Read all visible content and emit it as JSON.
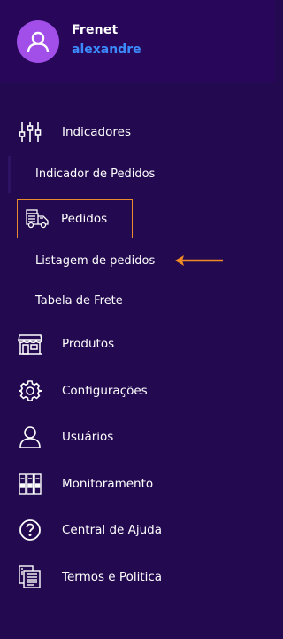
{
  "header": {
    "brand": "Frenet",
    "username": "alexandre"
  },
  "nav": {
    "indicadores": {
      "label": "Indicadores",
      "icon": "sliders-icon"
    },
    "indicador_pedidos": {
      "label": "Indicador de Pedidos"
    },
    "pedidos": {
      "label": "Pedidos",
      "icon": "delivery-truck-icon"
    },
    "listagem_pedidos": {
      "label": "Listagem de pedidos"
    },
    "tabela_frete": {
      "label": "Tabela de Frete"
    },
    "produtos": {
      "label": "Produtos",
      "icon": "store-icon"
    },
    "configuracoes": {
      "label": "Configurações",
      "icon": "gear-icon"
    },
    "usuarios": {
      "label": "Usuários",
      "icon": "user-icon"
    },
    "monitoramento": {
      "label": "Monitoramento",
      "icon": "binders-icon"
    },
    "central_ajuda": {
      "label": "Central de Ajuda",
      "icon": "help-circle-icon"
    },
    "termos": {
      "label": "Termos e Politica",
      "icon": "documents-icon"
    }
  },
  "colors": {
    "background": "#230a50",
    "header": "#28075a",
    "avatar": "#a24ee9",
    "username": "#3b8bff",
    "active_border": "#e88a2e",
    "arrow": "#f08a24"
  }
}
